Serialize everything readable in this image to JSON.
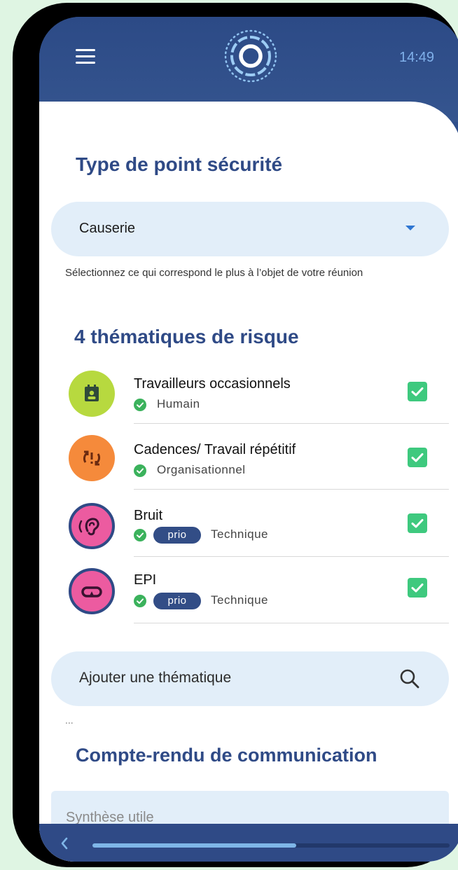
{
  "status": {
    "time": "14:49"
  },
  "header": {
    "menu_icon": "hamburger-menu-icon",
    "logo_icon": "dotted-ring-logo-icon"
  },
  "safety_point": {
    "title": "Type de point sécurité",
    "selected_value": "Causerie",
    "helper_text": "Sélectionnez ce qui correspond le plus à l’objet de votre réunion"
  },
  "themes": {
    "title": "4 thématiques de risque",
    "items": [
      {
        "name": "Travailleurs occasionnels",
        "category": "Humain",
        "prio_label": "",
        "icon": "id-badge-icon",
        "color": "#b7d93f",
        "checked": true
      },
      {
        "name": "Cadences/ Travail répétitif",
        "category": "Organisationnel",
        "prio_label": "",
        "icon": "repeat-alert-icon",
        "color": "#f58a3b",
        "checked": true
      },
      {
        "name": "Bruit",
        "category": "Technique",
        "prio_label": "prio",
        "icon": "ear-icon",
        "color": "#ec5ba0",
        "checked": true
      },
      {
        "name": "EPI",
        "category": "Technique",
        "prio_label": "prio",
        "icon": "safety-goggles-icon",
        "color": "#ec5ba0",
        "checked": true
      }
    ]
  },
  "add_theme": {
    "placeholder": "Ajouter une thématique",
    "icon": "search-icon"
  },
  "ellipsis": "...",
  "report": {
    "title": "Compte-rendu de communication",
    "placeholder": "Synthèse utile"
  },
  "colors": {
    "primary": "#2f4a86",
    "accent": "#2f76d2",
    "check": "#3ec97e",
    "field_bg": "#e2eef9"
  },
  "scroll": {
    "progress": 0.57
  }
}
